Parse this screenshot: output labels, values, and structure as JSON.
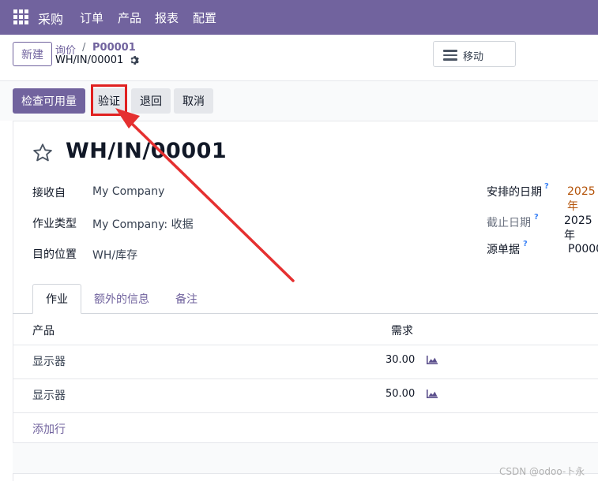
{
  "navbar": {
    "apps_icon": "apps-grid-icon",
    "brand": "采购",
    "menu": [
      "订单",
      "产品",
      "报表",
      "配置"
    ]
  },
  "control_panel": {
    "new_button": "新建",
    "breadcrumb_parent": "询价",
    "breadcrumb_separator": "/",
    "breadcrumb_po": "P00001",
    "breadcrumb_current": "WH/IN/00001",
    "settings_icon": "gear-icon",
    "move_button": "移动",
    "move_icon": "hamburger-icon"
  },
  "actions": {
    "check_availability": "检查可用量",
    "validate": "验证",
    "return": "退回",
    "cancel": "取消"
  },
  "form": {
    "favorite_icon": "star-icon",
    "title": "WH/IN/00001",
    "fields_left": [
      {
        "label": "接收自",
        "value": "My Company"
      },
      {
        "label": "作业类型",
        "value": "My Company: 收据"
      },
      {
        "label": "目的位置",
        "value": "WH/库存"
      }
    ],
    "fields_right": [
      {
        "label": "安排的日期",
        "help": "?",
        "value": "2025年"
      },
      {
        "label": "截止日期",
        "help": "?",
        "value": "2025年"
      },
      {
        "label": "源单据",
        "help": "?",
        "value": "P0000"
      }
    ]
  },
  "tabs": [
    {
      "label": "作业",
      "active": true
    },
    {
      "label": "额外的信息",
      "active": false
    },
    {
      "label": "备注",
      "active": false
    }
  ],
  "table": {
    "headers": {
      "product": "产品",
      "demand": "需求"
    },
    "rows": [
      {
        "product": "显示器",
        "demand": "30.00",
        "icon": "forecast-chart-icon"
      },
      {
        "product": "显示器",
        "demand": "50.00",
        "icon": "forecast-chart-icon"
      }
    ],
    "add_line": "添加行"
  },
  "watermark": "CSDN @odoo-卜永",
  "colors": {
    "brand": "#71639e",
    "highlight": "#e02020",
    "date_accent": "#b45309"
  }
}
